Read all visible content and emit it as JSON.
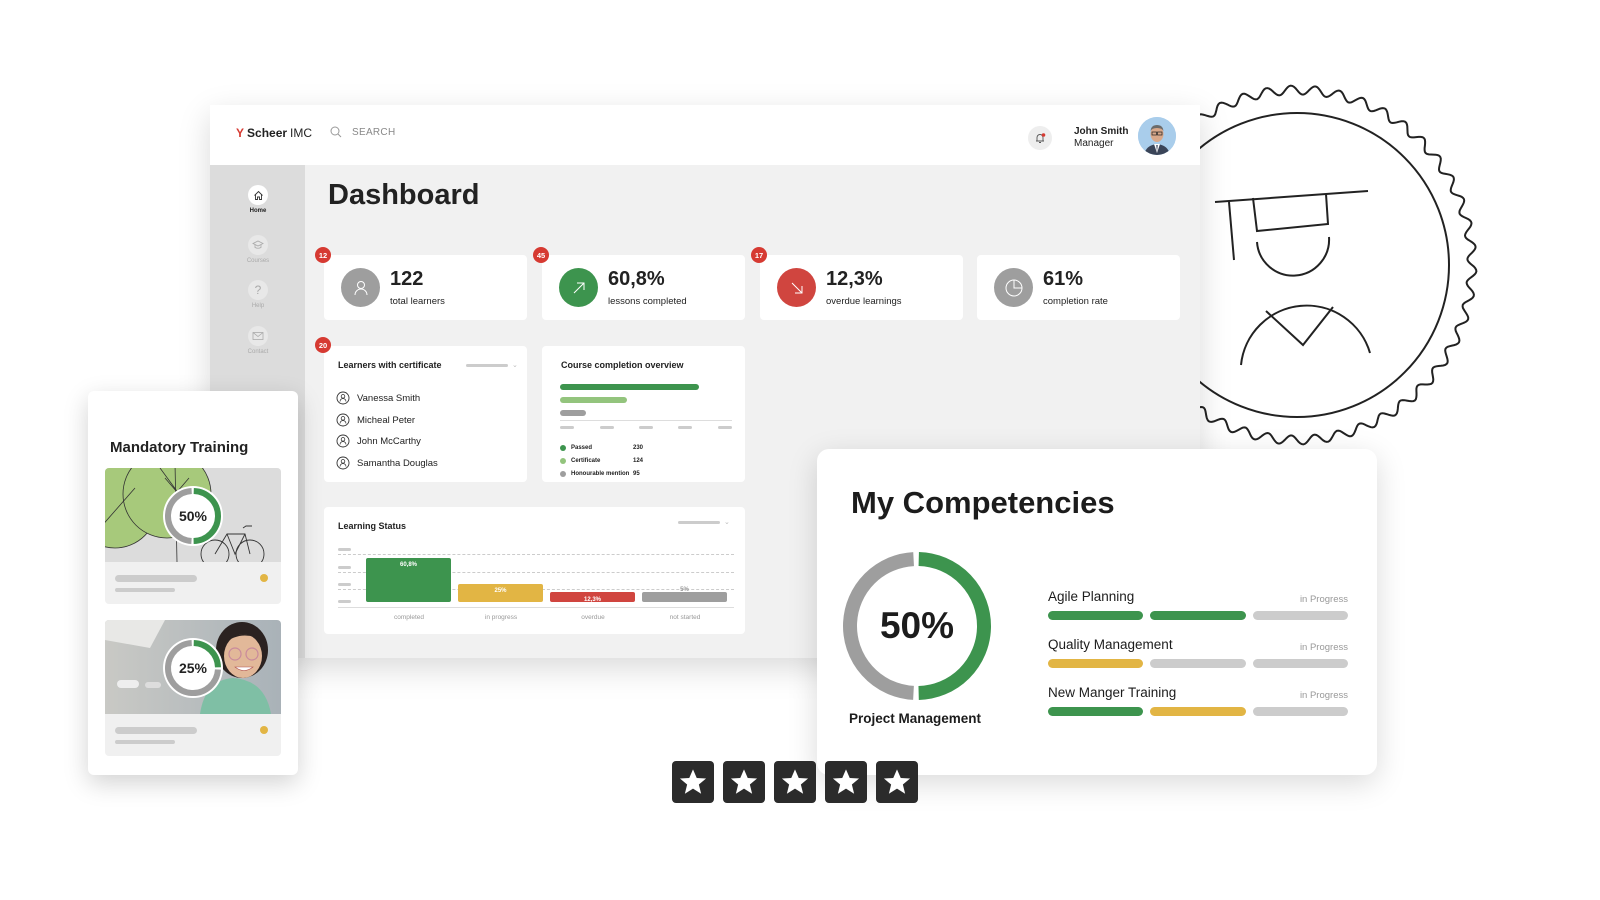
{
  "colors": {
    "green": "#3d944e",
    "light_green": "#93c47d",
    "red": "#d0453f",
    "yellow": "#e2b544",
    "gray": "#9e9e9e",
    "light_gray": "#cccccc",
    "badge_red": "#d63a32"
  },
  "header": {
    "logo_mark": "Y",
    "logo_bold": "Scheer",
    "logo_light": "IMC",
    "search_placeholder": "SEARCH",
    "notification_icon": "bell-icon",
    "user_name": "John Smith",
    "user_role": "Manager"
  },
  "sidebar": {
    "items": [
      {
        "label": "Home",
        "icon": "home-icon",
        "active": true
      },
      {
        "label": "Courses",
        "icon": "graduation-cap-icon",
        "active": false
      },
      {
        "label": "Help",
        "icon": "question-icon",
        "active": false
      },
      {
        "label": "Contact",
        "icon": "mail-icon",
        "active": false
      }
    ]
  },
  "page_title": "Dashboard",
  "kpis": [
    {
      "value": "122",
      "label": "total learners",
      "badge": "12",
      "icon": "user-icon"
    },
    {
      "value": "60,8%",
      "label": "lessons completed",
      "badge": "45",
      "icon": "arrow-up-right-icon"
    },
    {
      "value": "12,3%",
      "label": "overdue learnings",
      "badge": "17",
      "icon": "arrow-down-right-icon"
    },
    {
      "value": "61%",
      "label": "completion rate",
      "icon": "pie-chart-icon"
    }
  ],
  "learners_card": {
    "title": "Learners with certificate",
    "badge": "20",
    "learners": [
      "Vanessa Smith",
      "Micheal Peter",
      "John McCarthy",
      "Samantha Douglas"
    ]
  },
  "course_completion": {
    "title": "Course completion overview",
    "legend": [
      {
        "name": "Passed",
        "value": 230
      },
      {
        "name": "Certificate",
        "value": 124
      },
      {
        "name": "Honourable mention",
        "value": 95
      }
    ]
  },
  "learning_status": {
    "title": "Learning Status",
    "bars": [
      {
        "label": "completed",
        "value_label": "60,8%",
        "value": 60.8
      },
      {
        "label": "in progress",
        "value_label": "25%",
        "value": 25
      },
      {
        "label": "overdue",
        "value_label": "12,3%",
        "value": 12.3
      },
      {
        "label": "not started",
        "value_label": "5%",
        "value": 5
      }
    ]
  },
  "mandatory_training": {
    "title": "Mandatory Training",
    "courses": [
      {
        "progress_label": "50%",
        "progress": 0.5
      },
      {
        "progress_label": "25%",
        "progress": 0.25
      }
    ]
  },
  "competencies": {
    "title": "My Competencies",
    "main": {
      "label": "Project Management",
      "progress_label": "50%",
      "progress": 0.5
    },
    "skills": [
      {
        "name": "Agile Planning",
        "status": "in Progress",
        "segments": [
          "green",
          "green",
          "light_gray"
        ]
      },
      {
        "name": "Quality Management",
        "status": "in Progress",
        "segments": [
          "yellow",
          "light_gray",
          "light_gray"
        ]
      },
      {
        "name": "New Manger Training",
        "status": "in Progress",
        "segments": [
          "green",
          "yellow",
          "light_gray"
        ]
      }
    ]
  },
  "rating": {
    "stars": 5,
    "max": 5
  }
}
